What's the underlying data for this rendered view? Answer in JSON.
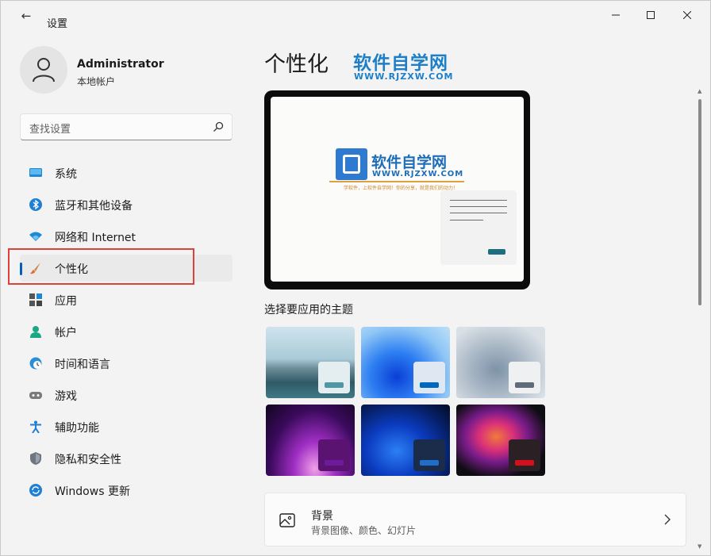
{
  "titlebar": {
    "back_icon": "arrow-left-icon",
    "title": "设置"
  },
  "profile": {
    "name": "Administrator",
    "type": "本地帐户"
  },
  "search": {
    "placeholder": "查找设置",
    "icon": "search-icon"
  },
  "nav": {
    "items": [
      {
        "label": "系统",
        "icon": "monitor-icon"
      },
      {
        "label": "蓝牙和其他设备",
        "icon": "bluetooth-icon"
      },
      {
        "label": "网络和 Internet",
        "icon": "wifi-icon"
      },
      {
        "label": "个性化",
        "icon": "brush-icon",
        "active": true
      },
      {
        "label": "应用",
        "icon": "apps-icon"
      },
      {
        "label": "帐户",
        "icon": "person-icon"
      },
      {
        "label": "时间和语言",
        "icon": "globe-clock-icon"
      },
      {
        "label": "游戏",
        "icon": "gamepad-icon"
      },
      {
        "label": "辅助功能",
        "icon": "accessibility-icon"
      },
      {
        "label": "隐私和安全性",
        "icon": "shield-icon"
      },
      {
        "label": "Windows 更新",
        "icon": "update-icon"
      }
    ]
  },
  "main": {
    "title": "个性化",
    "watermark": {
      "title": "软件自学网",
      "url": "WWW.RJZXW.COM"
    },
    "preview": {
      "logo_title": "软件自学网",
      "logo_url": "WWW.RJZXW.COM",
      "slogan": "学软件，上软件自学网！你的分享，就是我们的动力！"
    },
    "themes_title": "选择要应用的主题",
    "themes": [
      {
        "name": "glow-lake",
        "accent": "#4f97a3"
      },
      {
        "name": "windows-light",
        "accent": "#0067c0"
      },
      {
        "name": "captured-motion",
        "accent": "#5f6b78"
      },
      {
        "name": "glow-purple",
        "accent": "#6d1a9c"
      },
      {
        "name": "windows-dark",
        "accent": "#1f6fc9"
      },
      {
        "name": "flow-dark",
        "accent": "#d4101e"
      }
    ],
    "background_card": {
      "title": "背景",
      "subtitle": "背景图像、颜色、幻灯片",
      "icon": "image-icon"
    }
  },
  "colors": {
    "accent": "#005fb8",
    "highlight_box": "#e0403a"
  }
}
